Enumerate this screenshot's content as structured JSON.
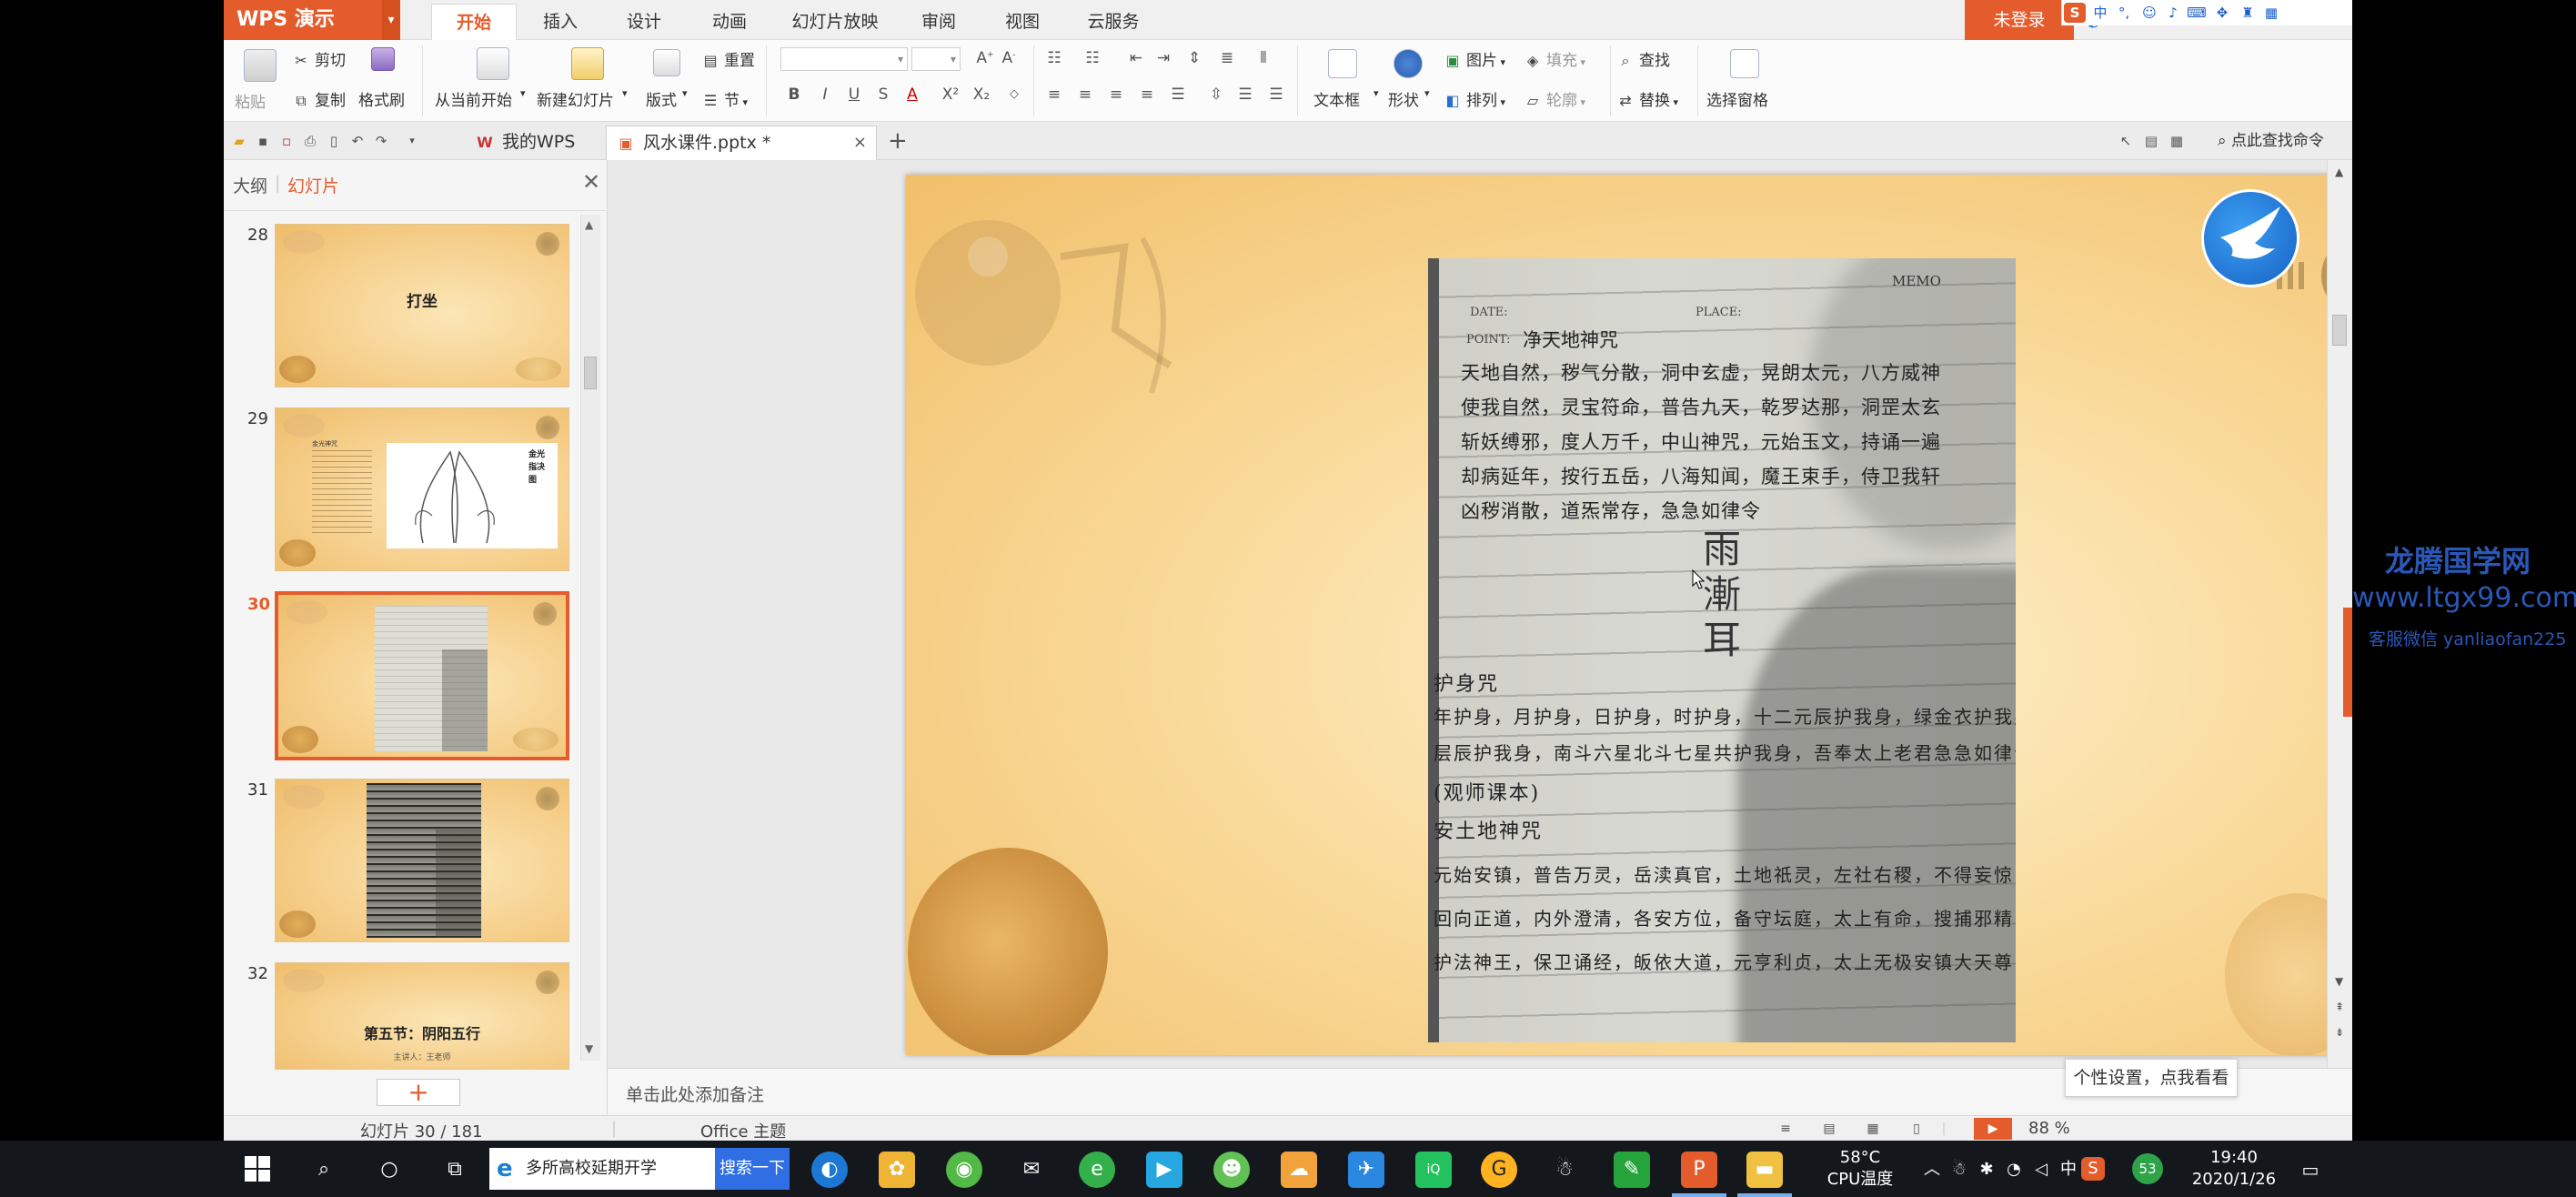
{
  "app": {
    "brand": "WPS 演示",
    "menu_tabs": [
      "开始",
      "插入",
      "设计",
      "动画",
      "幻灯片放映",
      "审阅",
      "视图",
      "云服务"
    ],
    "login": "未登录"
  },
  "ribbon": {
    "paste": "粘贴",
    "cut": "剪切",
    "copy": "复制",
    "format_painter": "格式刷",
    "from_current": "从当前开始",
    "new_slide": "新建幻灯片",
    "layout": "版式",
    "reset": "重置",
    "section": "节",
    "text_box": "文本框",
    "shape": "形状",
    "picture": "图片",
    "fill": "填充",
    "arrange": "排列",
    "outline": "轮廓",
    "find": "查找",
    "replace": "替换",
    "selection_pane": "选择窗格"
  },
  "tabs": {
    "my_wps": "我的WPS",
    "document": "风水课件.pptx *",
    "find_command": "点此查找命令"
  },
  "left_panel": {
    "outline_tab": "大纲",
    "slides_tab": "幻灯片",
    "slides": [
      {
        "num": "28",
        "title": "打坐"
      },
      {
        "num": "29",
        "title": "金光指决图",
        "side_text": "金光神咒"
      },
      {
        "num": "30",
        "title": ""
      },
      {
        "num": "31",
        "title": ""
      },
      {
        "num": "32",
        "title": "第五节：阴阳五行",
        "sub": "主讲人：王老师"
      }
    ],
    "active_slide": "30"
  },
  "slide": {
    "memo": "MEMO",
    "date": "DATE:",
    "place": "PLACE:",
    "point": "POINT:",
    "heading": "净天地神咒",
    "lines": [
      "天地自然，秽气分散，洞中玄虚，晃朗太元，八方威神",
      "使我自然，灵宝符命，普告九天，乾罗达那，洞罡太玄",
      "斩妖缚邪，度人万千，中山神咒，元始玉文，持诵一遍",
      "却病延年，按行五岳，八海知闻，魔王束手，侍卫我轩",
      "凶秽消散，道炁常存，急急如律令"
    ],
    "char1": "雨",
    "char2": "漸",
    "char3": "耳",
    "section_heading": "护身咒",
    "section_lines": [
      "年护身，月护身，日护身，时护身，十二元辰护我身，绿金衣护我身，金甲",
      "层辰护我身，南斗六星北斗七星共护我身，吾奉太上老君急急如律令",
      "(观师课本)",
      "安土地神咒",
      "元始安镇，普告万灵，岳渎真官，土地祇灵，左社右稷，不得妄惊",
      "回向正道，内外澄清，各安方位，备守坛庭，太上有命，搜捕邪精",
      "护法神王，保卫诵经，皈依大道，元亨利贞，太上无极安镇大天尊"
    ]
  },
  "notes": {
    "placeholder": "单击此处添加备注"
  },
  "status": {
    "slide_counter": "幻灯片 30 / 181",
    "theme": "Office 主题",
    "zoom": "88 %",
    "tooltip": "个性设置，点我看看"
  },
  "watermark": {
    "line1": "龙腾国学网",
    "line2": "www.ltgx99.com",
    "line3": "客服微信 yanliaofan225"
  },
  "taskbar": {
    "search_text": "多所高校延期开学",
    "search_btn": "搜索一下",
    "temp": "58°C",
    "cpu": "CPU温度",
    "ime": "中",
    "badge": "53",
    "time": "19:40",
    "date": "2020/1/26"
  },
  "colors": {
    "accent": "#e55c2c",
    "taskbar": "#14171c",
    "watermark": "#2a58b8"
  }
}
